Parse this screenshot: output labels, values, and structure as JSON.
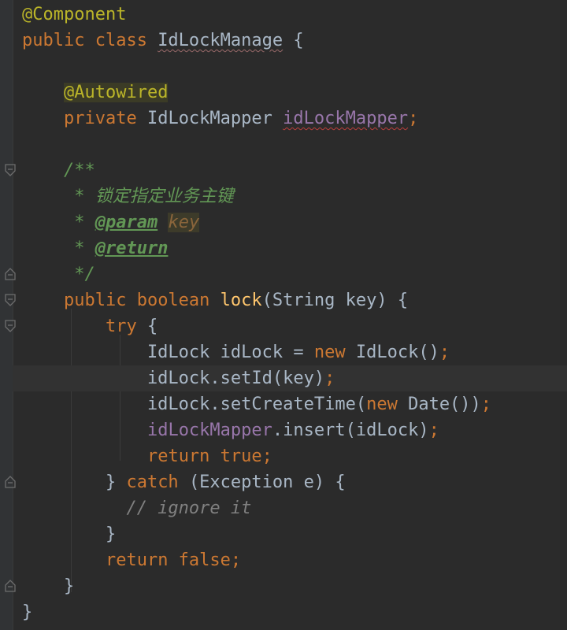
{
  "editor": {
    "lines": [
      {
        "tokens": [
          {
            "t": "@Component",
            "c": "ann"
          }
        ]
      },
      {
        "tokens": [
          {
            "t": "public class ",
            "c": "kw"
          },
          {
            "t": "IdLockManage",
            "c": "id",
            "squiggle": true
          },
          {
            "t": " {",
            "c": "id"
          }
        ]
      },
      {
        "tokens": []
      },
      {
        "tokens": [
          {
            "t": "    ",
            "c": "id"
          },
          {
            "t": "@Autowired",
            "c": "ann-hl"
          }
        ]
      },
      {
        "tokens": [
          {
            "t": "    ",
            "c": "id"
          },
          {
            "t": "private ",
            "c": "kw"
          },
          {
            "t": "IdLockMapper ",
            "c": "id"
          },
          {
            "t": "idLockMapper",
            "c": "field",
            "squiggle_red": true
          },
          {
            "t": ";",
            "c": "kw"
          }
        ]
      },
      {
        "tokens": []
      },
      {
        "tokens": [
          {
            "t": "    ",
            "c": "id"
          },
          {
            "t": "/**",
            "c": "doc"
          }
        ]
      },
      {
        "tokens": [
          {
            "t": "     * 锁定指定业务主键",
            "c": "doc"
          }
        ]
      },
      {
        "tokens": [
          {
            "t": "     * ",
            "c": "doc"
          },
          {
            "t": "@param",
            "c": "doctag"
          },
          {
            "t": " ",
            "c": "doc"
          },
          {
            "t": "key",
            "c": "docparam"
          }
        ]
      },
      {
        "tokens": [
          {
            "t": "     * ",
            "c": "doc"
          },
          {
            "t": "@return",
            "c": "doctag"
          }
        ]
      },
      {
        "tokens": [
          {
            "t": "     */",
            "c": "doc"
          }
        ]
      },
      {
        "tokens": [
          {
            "t": "    ",
            "c": "id"
          },
          {
            "t": "public boolean ",
            "c": "kw"
          },
          {
            "t": "lock",
            "c": "fn"
          },
          {
            "t": "(String key) {",
            "c": "id"
          }
        ]
      },
      {
        "tokens": [
          {
            "t": "        ",
            "c": "id"
          },
          {
            "t": "try ",
            "c": "kw"
          },
          {
            "t": "{",
            "c": "id"
          }
        ]
      },
      {
        "tokens": [
          {
            "t": "            IdLock idLock = ",
            "c": "id"
          },
          {
            "t": "new ",
            "c": "kw"
          },
          {
            "t": "IdLock()",
            "c": "id"
          },
          {
            "t": ";",
            "c": "kw"
          }
        ]
      },
      {
        "tokens": [
          {
            "t": "            idLock.setId(key)",
            "c": "id"
          },
          {
            "t": ";",
            "c": "kw"
          }
        ],
        "current": true
      },
      {
        "tokens": [
          {
            "t": "            idLock.setCreateTime(",
            "c": "id"
          },
          {
            "t": "new ",
            "c": "kw"
          },
          {
            "t": "Date())",
            "c": "id"
          },
          {
            "t": ";",
            "c": "kw"
          }
        ]
      },
      {
        "tokens": [
          {
            "t": "            ",
            "c": "id"
          },
          {
            "t": "idLockMapper",
            "c": "field"
          },
          {
            "t": ".insert(idLock)",
            "c": "id"
          },
          {
            "t": ";",
            "c": "kw"
          }
        ]
      },
      {
        "tokens": [
          {
            "t": "            ",
            "c": "id"
          },
          {
            "t": "return true;",
            "c": "kw"
          }
        ]
      },
      {
        "tokens": [
          {
            "t": "        } ",
            "c": "id"
          },
          {
            "t": "catch ",
            "c": "kw"
          },
          {
            "t": "(Exception e) {",
            "c": "id"
          }
        ]
      },
      {
        "tokens": [
          {
            "t": "          ",
            "c": "id"
          },
          {
            "t": "// ignore it",
            "c": "comment"
          }
        ]
      },
      {
        "tokens": [
          {
            "t": "        }",
            "c": "id"
          }
        ]
      },
      {
        "tokens": [
          {
            "t": "        ",
            "c": "id"
          },
          {
            "t": "return false;",
            "c": "kw"
          }
        ]
      },
      {
        "tokens": [
          {
            "t": "    }",
            "c": "id"
          }
        ]
      },
      {
        "tokens": [
          {
            "t": "}",
            "c": "id"
          }
        ]
      }
    ]
  },
  "gutter": {
    "fold_markers": [
      {
        "line": 6,
        "icon": "fold-open-icon"
      },
      {
        "line": 10,
        "icon": "fold-close-icon"
      },
      {
        "line": 11,
        "icon": "fold-open-icon"
      },
      {
        "line": 12,
        "icon": "fold-open-icon"
      },
      {
        "line": 18,
        "icon": "fold-close-icon"
      },
      {
        "line": 22,
        "icon": "fold-close-icon"
      }
    ]
  },
  "colors": {
    "background": "#2b2b2b",
    "keyword": "#cc7832",
    "annotation": "#bbb529",
    "method": "#ffc66d",
    "field": "#9876aa",
    "doc": "#629755",
    "comment": "#808080",
    "text": "#a9b7c6"
  }
}
